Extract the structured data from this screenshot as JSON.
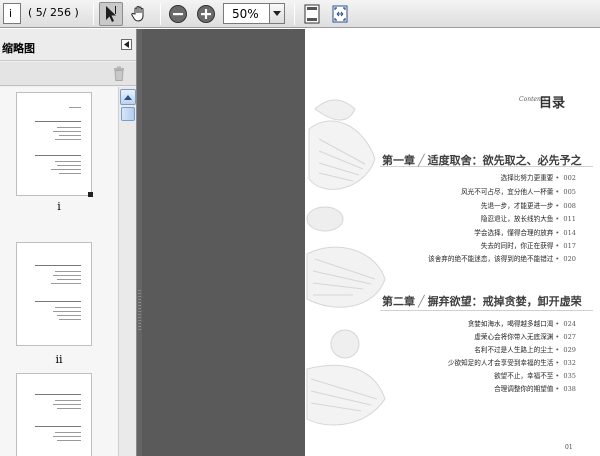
{
  "toolbar": {
    "current_page": "i",
    "page_count": "( 5/ 256 )",
    "zoom_value": "50%",
    "icons": [
      "select-arrow-icon",
      "hand-icon",
      "zoom-out-icon",
      "zoom-in-icon",
      "fit-page-icon",
      "fit-width-icon"
    ]
  },
  "panel": {
    "title": "缩略图",
    "thumbnails": [
      {
        "label": "i"
      },
      {
        "label": "ii"
      },
      {
        "label": ""
      }
    ]
  },
  "document": {
    "contents_label": "Contents",
    "toc_title": "目录",
    "chapters": [
      {
        "number": "第一章",
        "title": "适度取舍：欲先取之、必先予之",
        "entries": [
          {
            "text": "选择比努力更重要",
            "page": "002"
          },
          {
            "text": "风光不可占尽，宜分他人一杯羹",
            "page": "005"
          },
          {
            "text": "先退一步，才能更进一步",
            "page": "008"
          },
          {
            "text": "隐忍退让，放长线钓大鱼",
            "page": "011"
          },
          {
            "text": "学会选择，懂得合理的放弃",
            "page": "014"
          },
          {
            "text": "失去的同时，你正在获得",
            "page": "017"
          },
          {
            "text": "该舍弃的绝不能迷恋，该得到的绝不能错过",
            "page": "020"
          }
        ]
      },
      {
        "number": "第二章",
        "title": "摒弃欲望：戒掉贪婪，卸开虚荣",
        "entries": [
          {
            "text": "贪婪如海水，喝得越多越口渴",
            "page": "024"
          },
          {
            "text": "虚荣心会将你带入无底深渊",
            "page": "027"
          },
          {
            "text": "名利不过是人生路上的尘土",
            "page": "029"
          },
          {
            "text": "少欲知足的人才会享受到幸福的生活",
            "page": "032"
          },
          {
            "text": "欲望不止，幸福不至",
            "page": "035"
          },
          {
            "text": "合理调整你的期望值",
            "page": "038"
          }
        ]
      }
    ],
    "folio": "01"
  }
}
